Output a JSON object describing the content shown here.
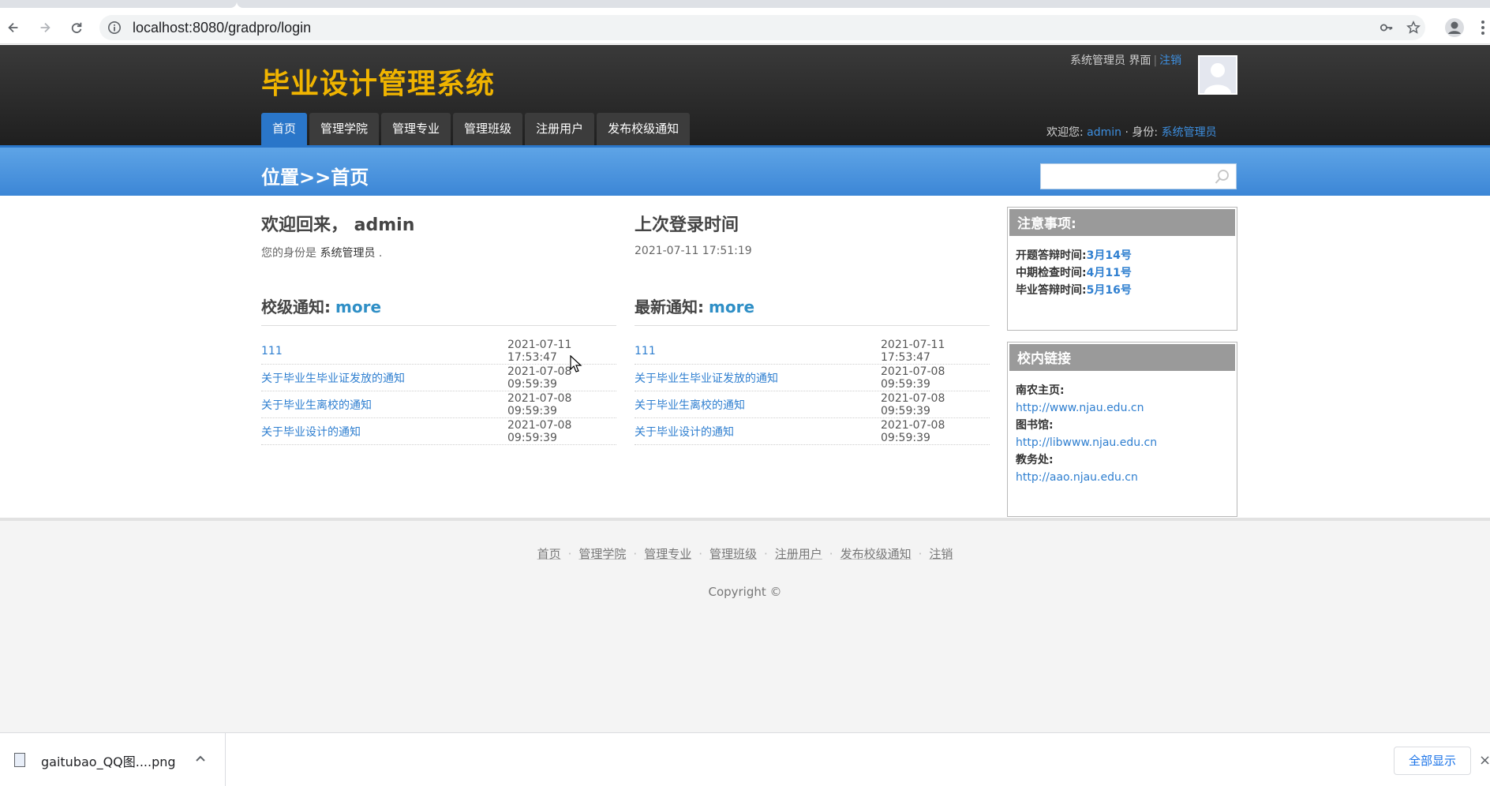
{
  "browser": {
    "url": "localhost:8080/gradpro/login"
  },
  "header": {
    "site_title": "毕业设计管理系统",
    "top_right": {
      "role_label": "系统管理员 界面",
      "sep": "|",
      "logout": "注销"
    },
    "nav": [
      "首页",
      "管理学院",
      "管理专业",
      "管理班级",
      "注册用户",
      "发布校级通知"
    ],
    "welcome": {
      "prefix": "欢迎您:",
      "user": "admin",
      "dot": "·",
      "role_prefix": "身份:",
      "role": "系统管理员"
    }
  },
  "location": {
    "text": "位置>>首页",
    "search_value": ""
  },
  "welcome_block": {
    "title": "欢迎回来， admin",
    "subtitle_prefix": "您的身份是",
    "subtitle_role": "系统管理员",
    "subtitle_suffix": "."
  },
  "last_login": {
    "title": "上次登录时间",
    "time": "2021-07-11 17:51:19"
  },
  "school_notices": {
    "title": "校级通知:",
    "more": "more",
    "items": [
      {
        "title": "111",
        "date": "2021-07-11 17:53:47"
      },
      {
        "title": "关于毕业生毕业证发放的通知",
        "date": "2021-07-08 09:59:39"
      },
      {
        "title": "关于毕业生离校的通知",
        "date": "2021-07-08 09:59:39"
      },
      {
        "title": "关于毕业设计的通知",
        "date": "2021-07-08 09:59:39"
      }
    ]
  },
  "latest_notices": {
    "title": "最新通知:",
    "more": "more",
    "items": [
      {
        "title": "111",
        "date": "2021-07-11 17:53:47"
      },
      {
        "title": "关于毕业生毕业证发放的通知",
        "date": "2021-07-08 09:59:39"
      },
      {
        "title": "关于毕业生离校的通知",
        "date": "2021-07-08 09:59:39"
      },
      {
        "title": "关于毕业设计的通知",
        "date": "2021-07-08 09:59:39"
      }
    ]
  },
  "notes": {
    "title": "注意事项:",
    "items": [
      {
        "label": "开题答辩时间:",
        "value": "3月14号"
      },
      {
        "label": "中期检查时间:",
        "value": "4月11号"
      },
      {
        "label": "毕业答辩时间:",
        "value": "5月16号"
      }
    ]
  },
  "links": {
    "title": "校内链接",
    "items": [
      {
        "label": "南农主页:",
        "url": "http://www.njau.edu.cn"
      },
      {
        "label": "图书馆:",
        "url": "http://libwww.njau.edu.cn"
      },
      {
        "label": "教务处:",
        "url": "http://aao.njau.edu.cn"
      }
    ]
  },
  "footer": {
    "links": [
      "首页",
      "管理学院",
      "管理专业",
      "管理班级",
      "注册用户",
      "发布校级通知",
      "注销"
    ],
    "dot": "·",
    "copyright": "Copyright ©"
  },
  "downloads": {
    "file_name": "gaitubao_QQ图....png",
    "show_all": "全部显示",
    "close": "×"
  }
}
